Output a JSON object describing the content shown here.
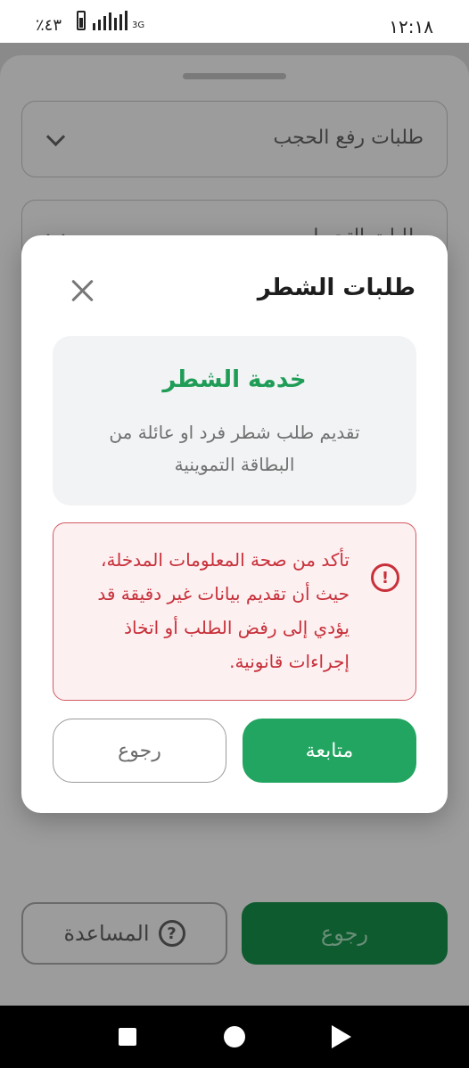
{
  "status_bar": {
    "time": "١٢:١٨",
    "battery": "٪٤٣",
    "network": "3G"
  },
  "background": {
    "select_1": "طلبات رفع الحجب",
    "select_2": "طلبات التحويل",
    "back_button": "رجوع",
    "help_button": "المساعدة",
    "help_icon": "?"
  },
  "modal": {
    "title": "طلبات الشطر",
    "close_icon": "close-icon",
    "service": {
      "title": "خدمة الشطر",
      "description": "تقديم طلب شطر فرد او عائلة من البطاقة التموينية"
    },
    "warning": {
      "icon": "!",
      "text": "تأكد من صحة المعلومات المدخلة، حيث أن تقديم بيانات غير دقيقة قد يؤدي إلى رفض الطلب أو اتخاذ إجراءات قانونية."
    },
    "continue_button": "متابعة",
    "back_button": "رجوع"
  },
  "colors": {
    "accent": "#22a560",
    "warning": "#c8303a"
  }
}
